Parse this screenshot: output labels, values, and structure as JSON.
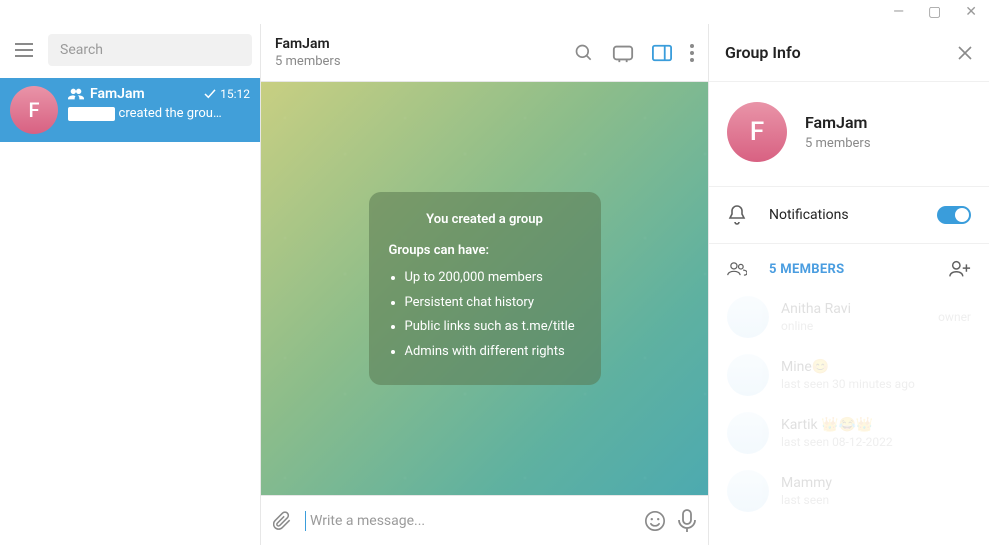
{
  "window": {
    "app": "Telegram"
  },
  "sidebar": {
    "searchPlaceholder": "Search",
    "chat": {
      "avatarLetter": "F",
      "name": "FamJam",
      "time": "15:12",
      "msgPrefix": "█████",
      "msgRest": " created the grou…"
    }
  },
  "chat": {
    "title": "FamJam",
    "subtitle": "5 members",
    "card": {
      "title": "You created a group",
      "lead": "Groups can have:",
      "items": [
        "Up to 200,000 members",
        "Persistent chat history",
        "Public links such as t.me/title",
        "Admins with different rights"
      ]
    },
    "composerPlaceholder": "Write a message..."
  },
  "info": {
    "title": "Group Info",
    "name": "FamJam",
    "subtitle": "5 members",
    "avatarLetter": "F",
    "notifLabel": "Notifications",
    "notifOn": true,
    "membersLabel": "5 MEMBERS",
    "members": [
      {
        "name": "Anitha Ravi",
        "status": "online",
        "role": "owner"
      },
      {
        "name": "Mine😊",
        "status": "last seen 30 minutes ago",
        "role": ""
      },
      {
        "name": "Kartik 👑😂👑",
        "status": "last seen 08-12-2022",
        "role": ""
      },
      {
        "name": "Mammy",
        "status": "last seen",
        "role": ""
      }
    ]
  }
}
